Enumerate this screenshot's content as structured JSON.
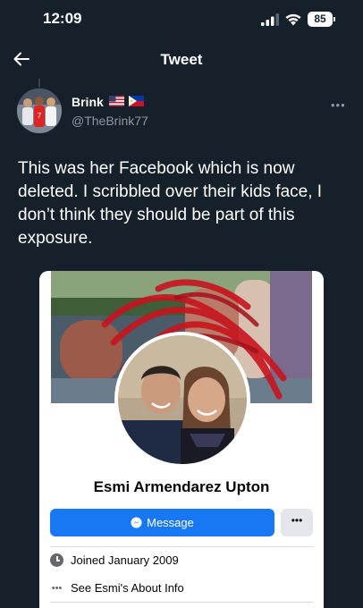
{
  "status_bar": {
    "time": "12:09",
    "battery": "85"
  },
  "nav": {
    "title": "Tweet"
  },
  "tweet": {
    "author_name": "Brink",
    "flags": [
      "US flag",
      "Philippines flag"
    ],
    "handle": "@TheBrink77",
    "text": "This was her Facebook which is now deleted. I scribbled over their kids face, I don’t think they should be part of this exposure."
  },
  "facebook_profile": {
    "name": "Esmi Armendarez Upton",
    "message_label": "Message",
    "more_label": "•••",
    "joined": "Joined January 2009",
    "about_link": "See Esmi's About Info"
  },
  "colors": {
    "background": "#15202b",
    "secondary_text": "#8b98a5",
    "fb_blue": "#1877f2",
    "scribble": "#c8141e"
  }
}
